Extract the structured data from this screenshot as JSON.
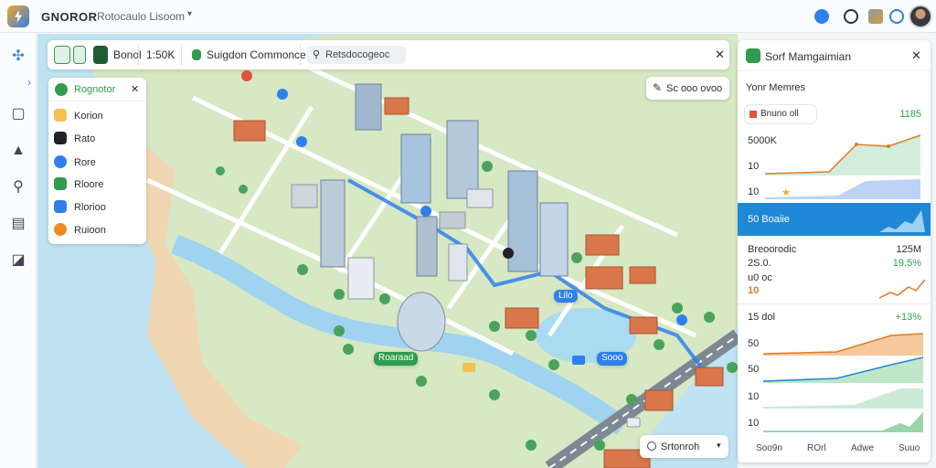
{
  "topbar": {
    "app_title": "GNOROR",
    "breadcrumb": "Rotocaulo Lisoom",
    "icons": [
      "logo-icon",
      "user-badge-icon",
      "clock-icon",
      "tools-icon",
      "status-ring-icon",
      "avatar"
    ]
  },
  "rail": {
    "icons": [
      "network-icon",
      "chevron-right-icon",
      "board-icon",
      "person-icon",
      "search-icon",
      "inbox-icon",
      "chart-icon"
    ]
  },
  "toolbar": {
    "mode_label": "Bonol",
    "zoom_label": "1:50K",
    "route_label": "Suigdon Commonce",
    "search_placeholder": "Retsdocogeoc"
  },
  "layers": {
    "title": "Rognotor",
    "items": [
      {
        "label": "Korion",
        "color": "#f2c14e"
      },
      {
        "label": "Rato",
        "color": "#1f2328"
      },
      {
        "label": "Rore",
        "color": "#2f80ed"
      },
      {
        "label": "Rloore",
        "color": "#2f9d4d"
      },
      {
        "label": "Rlorioo",
        "color": "#2f80ed"
      },
      {
        "label": "Ruioon",
        "color": "#f08a24"
      }
    ]
  },
  "map": {
    "chip_top_right": "Sc ooo ovoo",
    "pin_label_blue": "Lilo",
    "pin_label_green": "Roaraad",
    "pin_label_blue2": "Sooo",
    "chip_bottom": "Srtonroh"
  },
  "panel": {
    "title": "Sorf Mamgaimian",
    "subtitle": "Yonr Memres",
    "badge": "Bnuno oll",
    "badge_value": "1185",
    "chart1_ticks": [
      "5000K",
      "10",
      "10"
    ],
    "highlight_label": "50 Boaiie",
    "row2_label": "Breoorodic",
    "row2_value": "125M",
    "row3_label": "2S.0.",
    "row3_value": "19.5%",
    "row4_label": "u0 oc",
    "row5_label": "10",
    "row6_label": "15 dol",
    "row6_value": "+13%",
    "chart2_ticks": [
      "50",
      "50",
      "10",
      "10"
    ],
    "x_labels": [
      "Soo9n",
      "ROrl",
      "Adwe",
      "Suuo"
    ]
  },
  "colors": {
    "accent_blue": "#1e88d6",
    "green": "#2f9d4d",
    "orange": "#f08a24",
    "road_blue": "#2f80ed"
  }
}
